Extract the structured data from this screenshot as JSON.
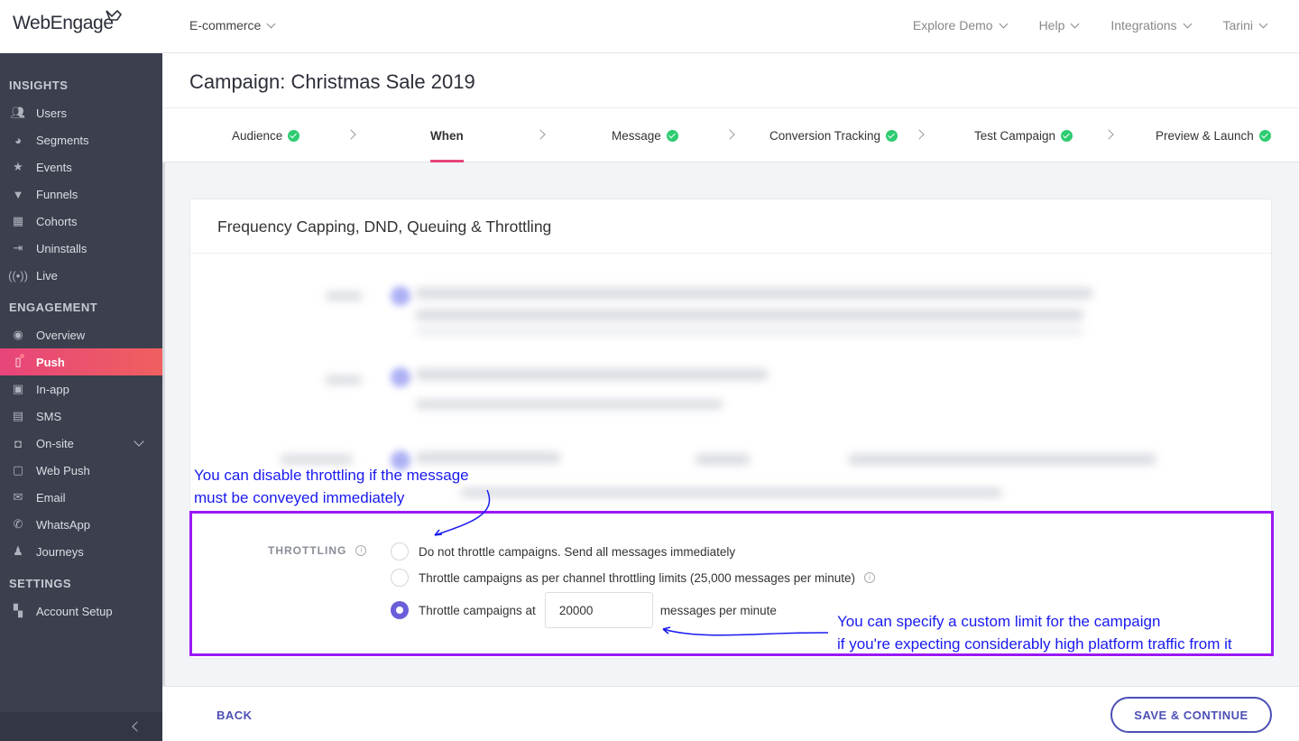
{
  "brand": {
    "logo_text": "WebEngage"
  },
  "topbar": {
    "project": "E-commerce",
    "nav": [
      "Explore Demo",
      "Help",
      "Integrations",
      "Tarini"
    ]
  },
  "sidebar": {
    "sections": [
      {
        "title": "INSIGHTS",
        "items": [
          {
            "label": "Users",
            "icon": "users-icon"
          },
          {
            "label": "Segments",
            "icon": "pie-icon"
          },
          {
            "label": "Events",
            "icon": "star-icon"
          },
          {
            "label": "Funnels",
            "icon": "funnel-icon"
          },
          {
            "label": "Cohorts",
            "icon": "grid-icon"
          },
          {
            "label": "Uninstalls",
            "icon": "exit-icon"
          },
          {
            "label": "Live",
            "icon": "broadcast-icon"
          }
        ]
      },
      {
        "title": "ENGAGEMENT",
        "items": [
          {
            "label": "Overview",
            "icon": "eye-icon"
          },
          {
            "label": "Push",
            "icon": "mobile-icon",
            "active": true
          },
          {
            "label": "In-app",
            "icon": "inapp-icon"
          },
          {
            "label": "SMS",
            "icon": "sms-icon"
          },
          {
            "label": "On-site",
            "icon": "onsite-icon"
          },
          {
            "label": "Web Push",
            "icon": "webpush-icon"
          },
          {
            "label": "Email",
            "icon": "mail-icon"
          },
          {
            "label": "WhatsApp",
            "icon": "whatsapp-icon"
          },
          {
            "label": "Journeys",
            "icon": "journey-icon"
          }
        ]
      },
      {
        "title": "SETTINGS",
        "items": [
          {
            "label": "Account Setup",
            "icon": "dashboard-icon"
          }
        ]
      }
    ]
  },
  "page": {
    "title": "Campaign: Christmas Sale 2019"
  },
  "steps": [
    {
      "label": "Audience",
      "done": true
    },
    {
      "label": "When",
      "active": true
    },
    {
      "label": "Message",
      "done": true
    },
    {
      "label": "Conversion Tracking",
      "done": true
    },
    {
      "label": "Test Campaign",
      "done": true
    },
    {
      "label": "Preview & Launch",
      "done": true
    }
  ],
  "card": {
    "title": "Frequency Capping, DND, Queuing & Throttling"
  },
  "throttling": {
    "label": "THROTTLING",
    "options": [
      "Do not throttle campaigns. Send all messages immediately",
      "Throttle campaigns as per channel throttling limits (25,000 messages per minute)",
      "Throttle campaigns at"
    ],
    "selected_index": 2,
    "rate_value": "20000",
    "rate_unit": "messages per minute"
  },
  "annotations": {
    "top_line1": "You can disable throttling if the message",
    "top_line2": "must be conveyed immediately",
    "bottom_line1": "You can specify a custom limit for the campaign",
    "bottom_line2": "if you're expecting considerably high platform traffic from it"
  },
  "footer": {
    "back": "BACK",
    "save": "SAVE & CONTINUE"
  },
  "colors": {
    "accent": "#e6457a",
    "primary": "#4d4fb5",
    "annotation": "#1a1af0",
    "highlight": "#9b19f5",
    "success": "#2ecc71"
  }
}
